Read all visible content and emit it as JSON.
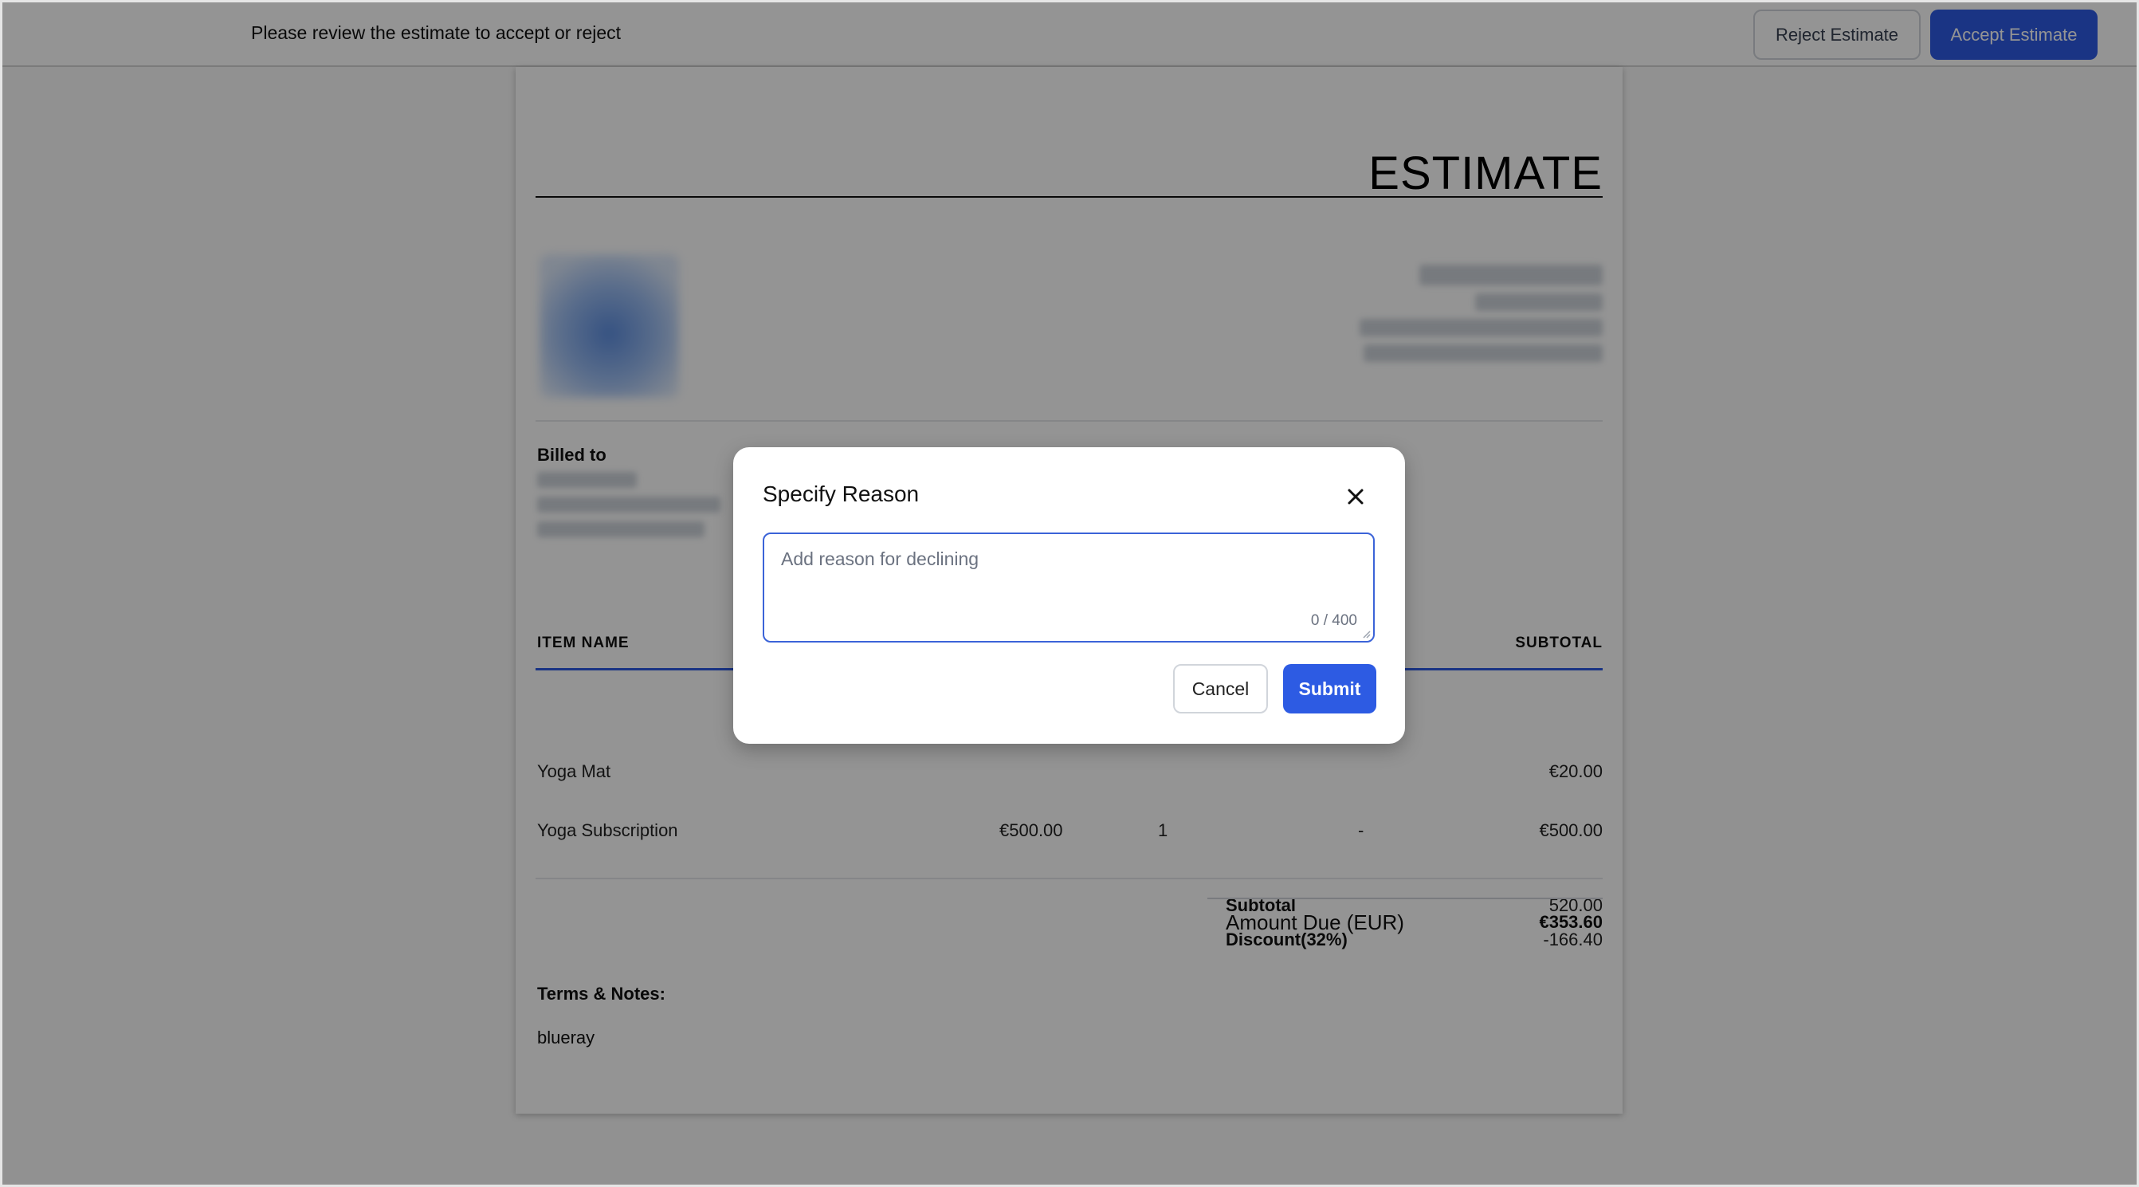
{
  "topbar": {
    "message": "Please review the estimate to accept or reject",
    "reject_label": "Reject Estimate",
    "accept_label": "Accept Estimate"
  },
  "document": {
    "title": "ESTIMATE",
    "billed_to_label": "Billed to",
    "table": {
      "headers": {
        "item_name": "ITEM NAME",
        "subtotal": "SUBTOTAL"
      },
      "rows": [
        {
          "name": "Yoga Mat",
          "subtotal": "€20.00"
        },
        {
          "name": "Yoga Subscription",
          "price": "€500.00",
          "qty": "1",
          "discount": "-",
          "subtotal": "€500.00"
        }
      ]
    },
    "totals": {
      "subtotal_label": "Subtotal",
      "subtotal_value": "520.00",
      "discount_label": "Discount(32%)",
      "discount_value": "-166.40",
      "amount_due_label": "Amount Due (EUR)",
      "amount_due_value": "€353.60"
    },
    "terms_label": "Terms & Notes:",
    "terms_value": "blueray"
  },
  "modal": {
    "title": "Specify Reason",
    "reason_placeholder": "Add reason for declining",
    "reason_value": "",
    "char_count": "0 / 400",
    "cancel_label": "Cancel",
    "submit_label": "Submit"
  },
  "colors": {
    "primary": "#2d5be3",
    "overlay": "rgba(0,0,0,0.42)"
  },
  "icons": {
    "close": "close-icon"
  }
}
